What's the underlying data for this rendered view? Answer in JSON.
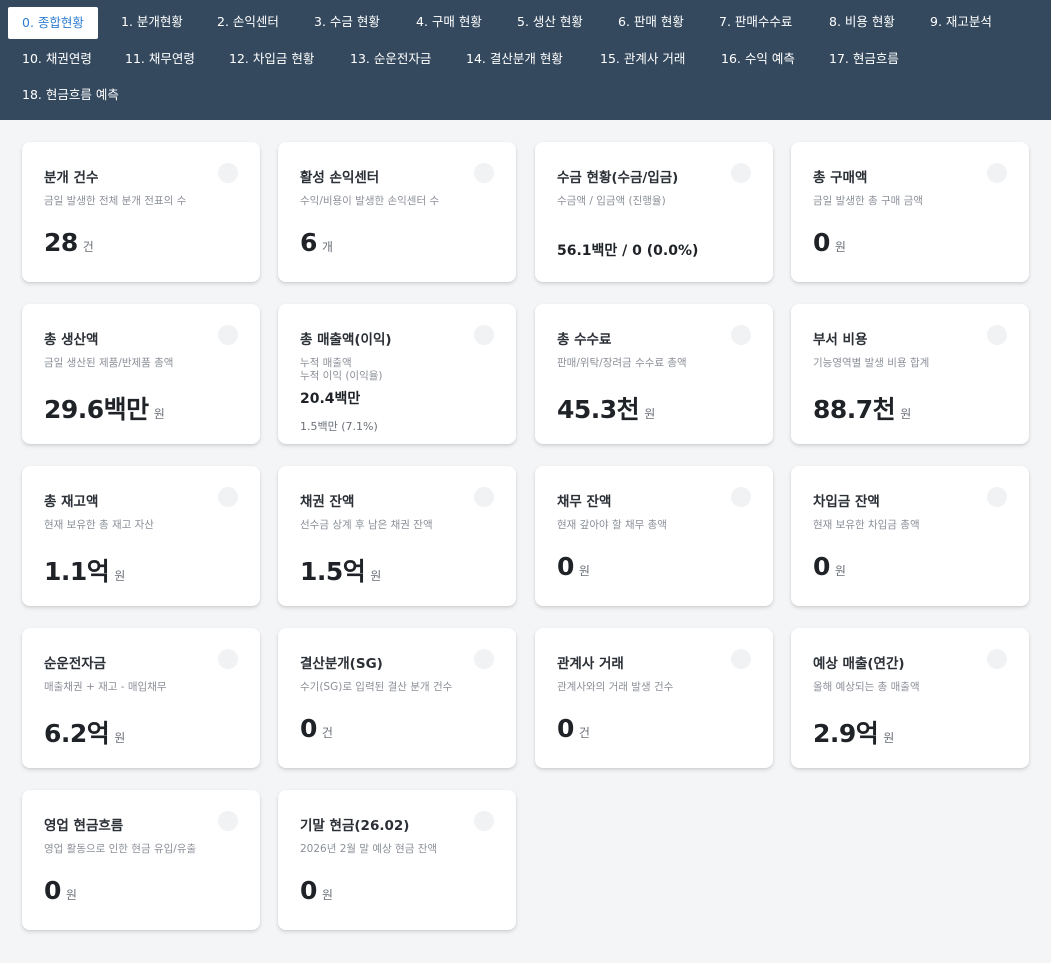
{
  "tabs": [
    "0. 종합현황",
    "1. 분개현황",
    "2. 손익센터",
    "3. 수금 현황",
    "4. 구매 현황",
    "5. 생산 현황",
    "6. 판매 현황",
    "7. 판매수수료",
    "8. 비용 현황",
    "9. 재고분석",
    "10. 채권연령",
    "11. 채무연령",
    "12. 차입금 현황",
    "13. 순운전자금",
    "14. 결산분개 현황",
    "15. 관계사 거래",
    "16. 수익 예측",
    "17. 현금흐름",
    "18. 현금흐름 예측"
  ],
  "colors": {
    "nav_bg": "#34495e",
    "active_tab_text": "#2f7dd1"
  },
  "cards": [
    {
      "title": "분개 건수",
      "desc": "금일 발생한 전체 분개 전표의 수",
      "value": "28",
      "unit": "건"
    },
    {
      "title": "활성 손익센터",
      "desc": "수익/비용이 발생한 손익센터 수",
      "value": "6",
      "unit": "개"
    },
    {
      "title": "수금 현황(수금/입금)",
      "desc": "수금액 / 입금액 (진행율)",
      "value": "56.1백만 / 0 (0.0%)",
      "unit": ""
    },
    {
      "title": "총 구매액",
      "desc": "금일 발생한 총 구매 금액",
      "value": "0",
      "unit": "원"
    },
    {
      "title": "총 생산액",
      "desc": "금일 생산된 제품/반제품 총액",
      "value": "29.6백만",
      "unit": "원"
    },
    {
      "title": "총 매출액(이익)",
      "desc": "누적 매출액",
      "desc2": "누적 이익 (이익율)",
      "value": "20.4백만",
      "value2": "1.5백만 (7.1%)"
    },
    {
      "title": "총 수수료",
      "desc": "판매/위탁/장려금 수수료 총액",
      "value": "45.3천",
      "unit": "원"
    },
    {
      "title": "부서 비용",
      "desc": "기능영역별 발생 비용 합계",
      "value": "88.7천",
      "unit": "원"
    },
    {
      "title": "총 재고액",
      "desc": "현재 보유한 총 재고 자산",
      "value": "1.1억",
      "unit": "원"
    },
    {
      "title": "채권 잔액",
      "desc": "선수금 상계 후 남은 채권 잔액",
      "value": "1.5억",
      "unit": "원"
    },
    {
      "title": "채무 잔액",
      "desc": "현재 갚아야 할 채무 총액",
      "value": "0",
      "unit": "원"
    },
    {
      "title": "차입금 잔액",
      "desc": "현재 보유한 차입금 총액",
      "value": "0",
      "unit": "원"
    },
    {
      "title": "순운전자금",
      "desc": "매출채권 + 재고 - 매입채무",
      "value": "6.2억",
      "unit": "원"
    },
    {
      "title": "결산분개(SG)",
      "desc": "수기(SG)로 입력된 결산 분개 건수",
      "value": "0",
      "unit": "건"
    },
    {
      "title": "관계사 거래",
      "desc": "관계사와의 거래 발생 건수",
      "value": "0",
      "unit": "건"
    },
    {
      "title": "예상 매출(연간)",
      "desc": "올해 예상되는 총 매출액",
      "value": "2.9억",
      "unit": "원"
    },
    {
      "title": "영업 현금흐름",
      "desc": "영업 활동으로 인한 현금 유입/유출",
      "value": "0",
      "unit": "원"
    },
    {
      "title": "기말 현금(26.02)",
      "desc": "2026년 2월 말 예상 현금 잔액",
      "value": "0",
      "unit": "원"
    }
  ]
}
